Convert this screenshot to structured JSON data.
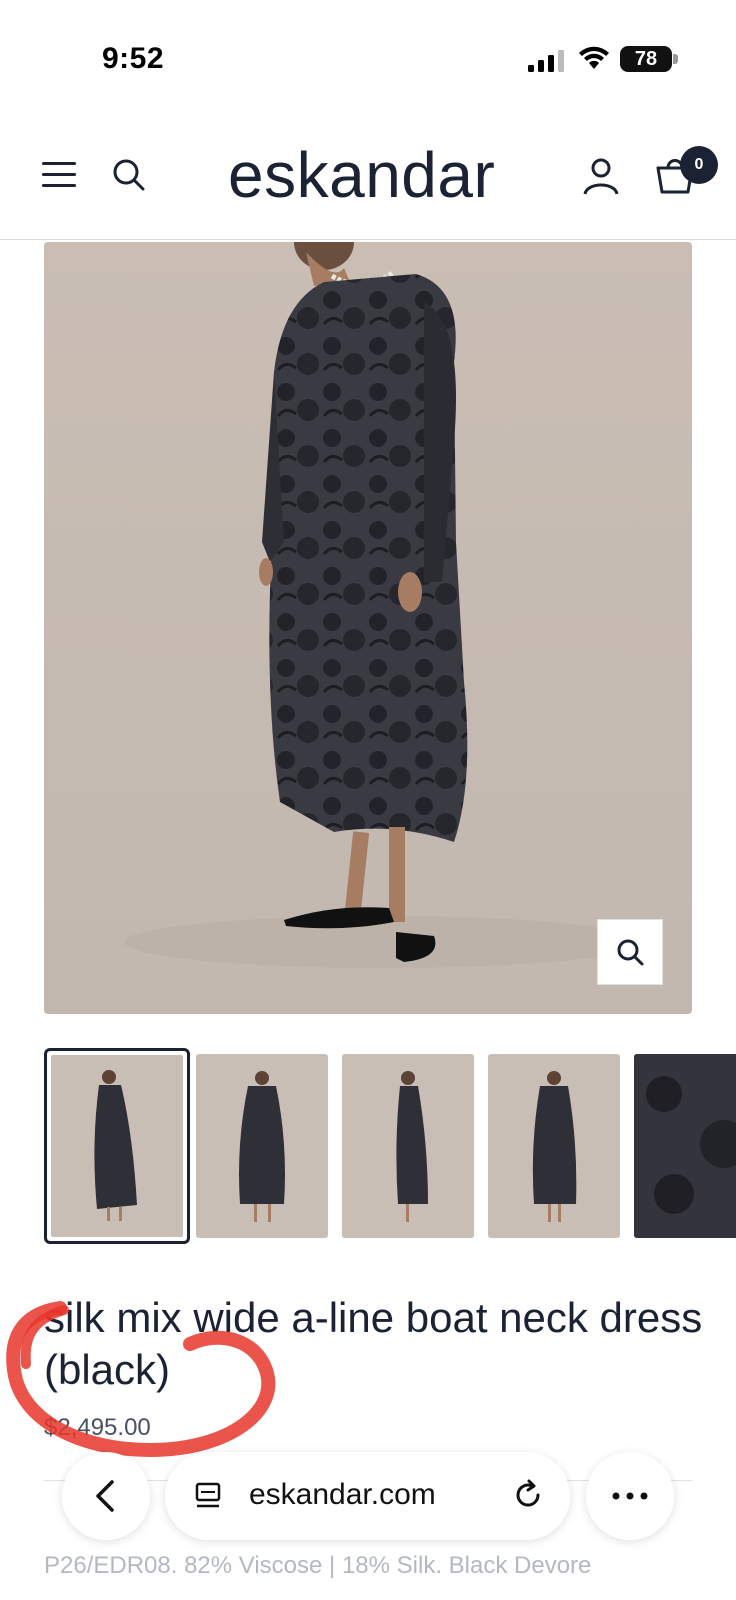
{
  "status_bar": {
    "time": "9:52",
    "battery": "78"
  },
  "header": {
    "logo": "eskandar",
    "cart_count": "0",
    "icons": [
      "menu-icon",
      "search-icon",
      "account-icon",
      "cart-icon"
    ]
  },
  "gallery": {
    "thumbnail_count": 5,
    "active_index": 0
  },
  "product": {
    "title": "silk mix wide a-line boat neck dress (black)",
    "price": "$2,495.00",
    "description": "P26/EDR08. 82% Viscose | 18% Silk. Black Devore"
  },
  "browser": {
    "url": "eskandar.com",
    "icons": [
      "back-icon",
      "tabs-icon",
      "reload-icon",
      "more-icon"
    ]
  },
  "colors": {
    "brand_navy": "#1a2233",
    "highlight_red": "#e8362c",
    "image_background": "#c8beb5"
  }
}
